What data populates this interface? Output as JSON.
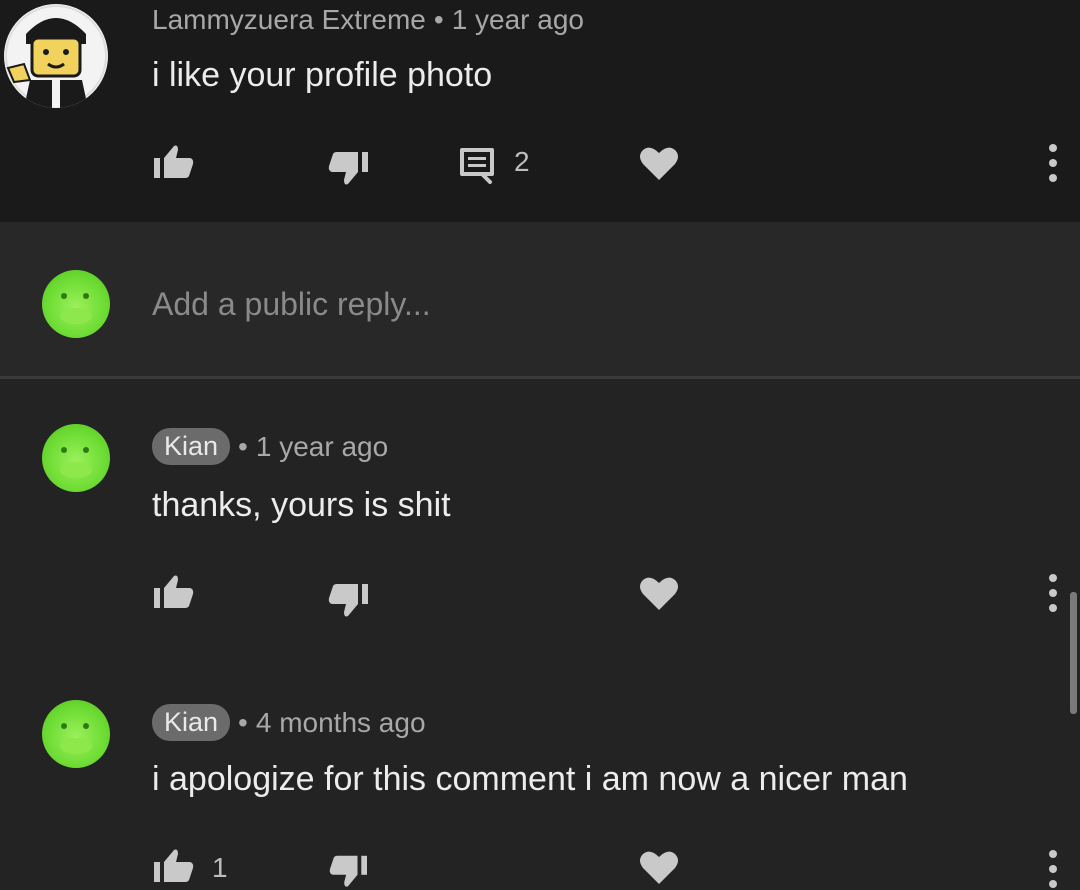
{
  "comments": [
    {
      "author": "Lammyzuera Extreme",
      "separator": "•",
      "time": "1 year ago",
      "text": "i like your profile photo",
      "reply_count": "2"
    },
    {
      "author": "Kian",
      "separator": "•",
      "time": "1 year ago",
      "text": "thanks, yours is shit"
    },
    {
      "author": "Kian",
      "separator": "•",
      "time": "4 months ago",
      "text": "i apologize for this comment i am now a nicer man",
      "like_count": "1"
    }
  ],
  "reply_box": {
    "placeholder": "Add a public reply..."
  },
  "colors": {
    "background": "#232323",
    "top_background": "#1a1a1a",
    "avatar_green": "#6fdd35",
    "chip": "#6b6b6b"
  },
  "icons": [
    "thumbs-up-icon",
    "thumbs-down-icon",
    "comment-icon",
    "heart-icon",
    "more-vert-icon"
  ]
}
